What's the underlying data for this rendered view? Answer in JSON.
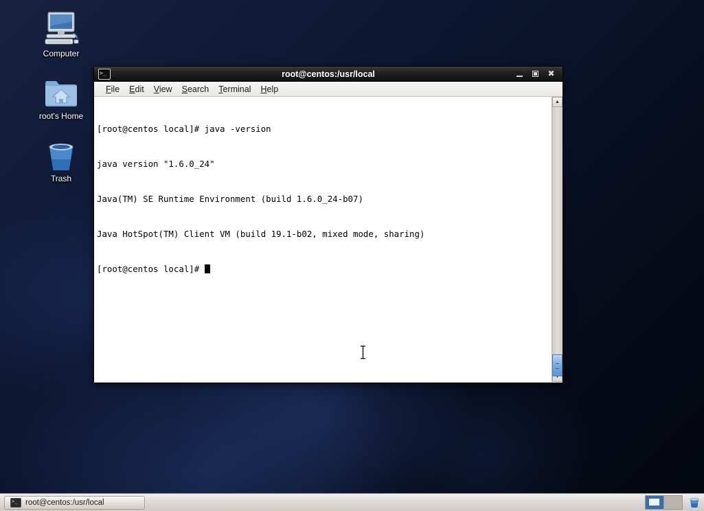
{
  "desktop": {
    "icons": [
      {
        "label": "Computer",
        "icon": "computer-icon"
      },
      {
        "label": "root's Home",
        "icon": "home-folder-icon"
      },
      {
        "label": "Trash",
        "icon": "trash-icon"
      }
    ]
  },
  "window": {
    "title": "root@centos:/usr/local",
    "icon": "terminal-icon",
    "buttons": {
      "minimize": "minimize-button",
      "maximize": "maximize-button",
      "close": "✖"
    },
    "menu": [
      {
        "label": "File",
        "mnemonic": "F",
        "rest": "ile"
      },
      {
        "label": "Edit",
        "mnemonic": "E",
        "rest": "dit"
      },
      {
        "label": "View",
        "mnemonic": "V",
        "rest": "iew"
      },
      {
        "label": "Search",
        "mnemonic": "S",
        "rest": "earch"
      },
      {
        "label": "Terminal",
        "mnemonic": "T",
        "rest": "erminal"
      },
      {
        "label": "Help",
        "mnemonic": "H",
        "rest": "elp"
      }
    ],
    "terminal": {
      "lines": [
        "[root@centos local]# java -version",
        "java version \"1.6.0_24\"",
        "Java(TM) SE Runtime Environment (build 1.6.0_24-b07)",
        "Java HotSpot(TM) Client VM (build 19.1-b02, mixed mode, sharing)"
      ],
      "prompt": "[root@centos local]# ",
      "foreground": "#000000",
      "background": "#ffffff"
    },
    "scrollbar": {
      "up_arrow": "▲",
      "down_arrow": "▼"
    }
  },
  "taskbar": {
    "window_button": {
      "label": "root@centos:/usr/local",
      "icon": "terminal-icon"
    },
    "workspaces": [
      {
        "name": "workspace-1",
        "active": true
      },
      {
        "name": "workspace-2",
        "active": false
      }
    ],
    "trash_applet": "trash-applet-icon"
  }
}
